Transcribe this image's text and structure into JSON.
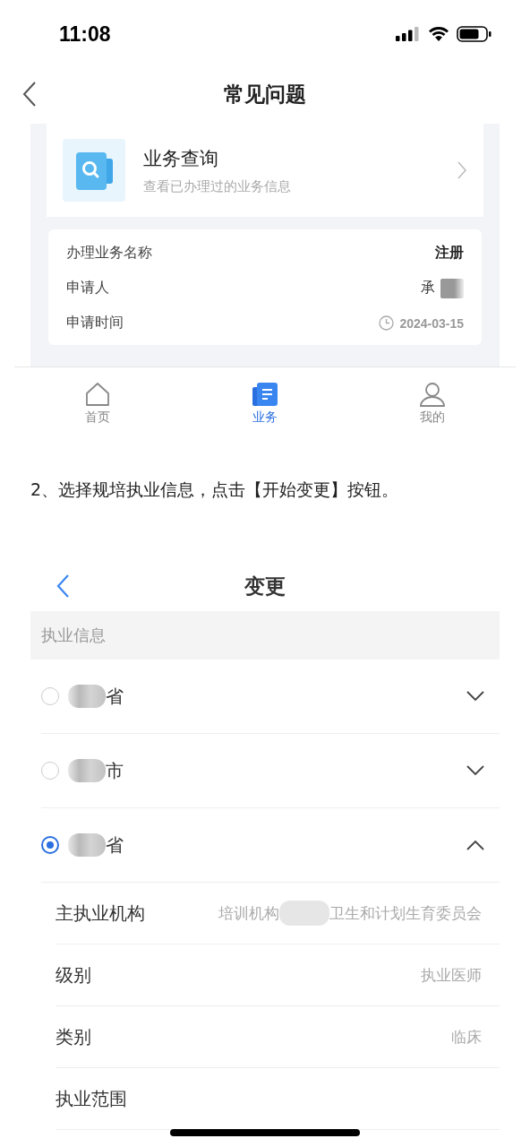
{
  "status_bar": {
    "time": "11:08"
  },
  "nav": {
    "title": "常见问题"
  },
  "shot1": {
    "query_card": {
      "title": "业务查询",
      "subtitle": "查看已办理过的业务信息"
    },
    "record": [
      {
        "label": "办理业务名称",
        "value": "注册",
        "kind": "bold"
      },
      {
        "label": "申请人",
        "value": "承",
        "kind": "name"
      },
      {
        "label": "申请时间",
        "value": "2024-03-15",
        "kind": "time"
      }
    ],
    "tabs": [
      {
        "label": "首页",
        "selected": false,
        "kind": "home"
      },
      {
        "label": "业务",
        "selected": true,
        "kind": "business"
      },
      {
        "label": "我的",
        "selected": false,
        "kind": "profile"
      }
    ]
  },
  "instruction": "2、选择规培执业信息，点击【开始变更】按钮。",
  "shot2": {
    "title": "变更",
    "section": "执业信息",
    "regions": [
      {
        "label": "省",
        "selected": false,
        "expanded": false
      },
      {
        "label": "市",
        "selected": false,
        "expanded": false
      },
      {
        "label": "省",
        "selected": true,
        "expanded": true
      }
    ],
    "details": [
      {
        "label": "主执业机构",
        "value_parts": [
          "培训机构",
          "卫生和计划生育委员会"
        ]
      },
      {
        "label": "级别",
        "value_parts": [
          "执业医师"
        ]
      },
      {
        "label": "类别",
        "value_parts": [
          "临床"
        ]
      },
      {
        "label": "执业范围"
      }
    ]
  }
}
